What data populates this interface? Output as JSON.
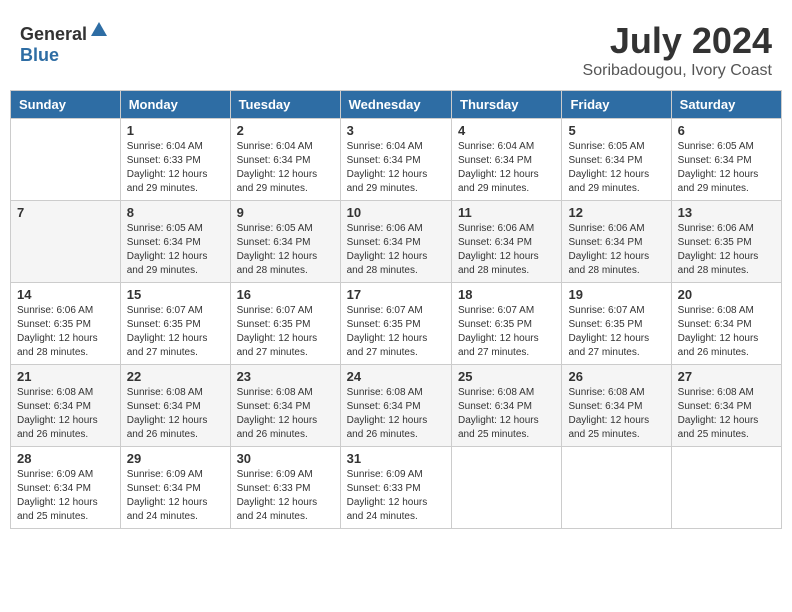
{
  "header": {
    "logo_general": "General",
    "logo_blue": "Blue",
    "month_year": "July 2024",
    "location": "Soribadougou, Ivory Coast"
  },
  "calendar": {
    "days_of_week": [
      "Sunday",
      "Monday",
      "Tuesday",
      "Wednesday",
      "Thursday",
      "Friday",
      "Saturday"
    ],
    "weeks": [
      [
        {
          "day": "",
          "info": ""
        },
        {
          "day": "1",
          "info": "Sunrise: 6:04 AM\nSunset: 6:33 PM\nDaylight: 12 hours\nand 29 minutes."
        },
        {
          "day": "2",
          "info": "Sunrise: 6:04 AM\nSunset: 6:34 PM\nDaylight: 12 hours\nand 29 minutes."
        },
        {
          "day": "3",
          "info": "Sunrise: 6:04 AM\nSunset: 6:34 PM\nDaylight: 12 hours\nand 29 minutes."
        },
        {
          "day": "4",
          "info": "Sunrise: 6:04 AM\nSunset: 6:34 PM\nDaylight: 12 hours\nand 29 minutes."
        },
        {
          "day": "5",
          "info": "Sunrise: 6:05 AM\nSunset: 6:34 PM\nDaylight: 12 hours\nand 29 minutes."
        },
        {
          "day": "6",
          "info": "Sunrise: 6:05 AM\nSunset: 6:34 PM\nDaylight: 12 hours\nand 29 minutes."
        }
      ],
      [
        {
          "day": "7",
          "info": ""
        },
        {
          "day": "8",
          "info": "Sunrise: 6:05 AM\nSunset: 6:34 PM\nDaylight: 12 hours\nand 29 minutes."
        },
        {
          "day": "9",
          "info": "Sunrise: 6:05 AM\nSunset: 6:34 PM\nDaylight: 12 hours\nand 28 minutes."
        },
        {
          "day": "10",
          "info": "Sunrise: 6:06 AM\nSunset: 6:34 PM\nDaylight: 12 hours\nand 28 minutes."
        },
        {
          "day": "11",
          "info": "Sunrise: 6:06 AM\nSunset: 6:34 PM\nDaylight: 12 hours\nand 28 minutes."
        },
        {
          "day": "12",
          "info": "Sunrise: 6:06 AM\nSunset: 6:34 PM\nDaylight: 12 hours\nand 28 minutes."
        },
        {
          "day": "13",
          "info": "Sunrise: 6:06 AM\nSunset: 6:35 PM\nDaylight: 12 hours\nand 28 minutes."
        }
      ],
      [
        {
          "day": "14",
          "info": "Sunrise: 6:06 AM\nSunset: 6:35 PM\nDaylight: 12 hours\nand 28 minutes."
        },
        {
          "day": "15",
          "info": "Sunrise: 6:07 AM\nSunset: 6:35 PM\nDaylight: 12 hours\nand 27 minutes."
        },
        {
          "day": "16",
          "info": "Sunrise: 6:07 AM\nSunset: 6:35 PM\nDaylight: 12 hours\nand 27 minutes."
        },
        {
          "day": "17",
          "info": "Sunrise: 6:07 AM\nSunset: 6:35 PM\nDaylight: 12 hours\nand 27 minutes."
        },
        {
          "day": "18",
          "info": "Sunrise: 6:07 AM\nSunset: 6:35 PM\nDaylight: 12 hours\nand 27 minutes."
        },
        {
          "day": "19",
          "info": "Sunrise: 6:07 AM\nSunset: 6:35 PM\nDaylight: 12 hours\nand 27 minutes."
        },
        {
          "day": "20",
          "info": "Sunrise: 6:08 AM\nSunset: 6:34 PM\nDaylight: 12 hours\nand 26 minutes."
        }
      ],
      [
        {
          "day": "21",
          "info": "Sunrise: 6:08 AM\nSunset: 6:34 PM\nDaylight: 12 hours\nand 26 minutes."
        },
        {
          "day": "22",
          "info": "Sunrise: 6:08 AM\nSunset: 6:34 PM\nDaylight: 12 hours\nand 26 minutes."
        },
        {
          "day": "23",
          "info": "Sunrise: 6:08 AM\nSunset: 6:34 PM\nDaylight: 12 hours\nand 26 minutes."
        },
        {
          "day": "24",
          "info": "Sunrise: 6:08 AM\nSunset: 6:34 PM\nDaylight: 12 hours\nand 26 minutes."
        },
        {
          "day": "25",
          "info": "Sunrise: 6:08 AM\nSunset: 6:34 PM\nDaylight: 12 hours\nand 25 minutes."
        },
        {
          "day": "26",
          "info": "Sunrise: 6:08 AM\nSunset: 6:34 PM\nDaylight: 12 hours\nand 25 minutes."
        },
        {
          "day": "27",
          "info": "Sunrise: 6:08 AM\nSunset: 6:34 PM\nDaylight: 12 hours\nand 25 minutes."
        }
      ],
      [
        {
          "day": "28",
          "info": "Sunrise: 6:09 AM\nSunset: 6:34 PM\nDaylight: 12 hours\nand 25 minutes."
        },
        {
          "day": "29",
          "info": "Sunrise: 6:09 AM\nSunset: 6:34 PM\nDaylight: 12 hours\nand 24 minutes."
        },
        {
          "day": "30",
          "info": "Sunrise: 6:09 AM\nSunset: 6:33 PM\nDaylight: 12 hours\nand 24 minutes."
        },
        {
          "day": "31",
          "info": "Sunrise: 6:09 AM\nSunset: 6:33 PM\nDaylight: 12 hours\nand 24 minutes."
        },
        {
          "day": "",
          "info": ""
        },
        {
          "day": "",
          "info": ""
        },
        {
          "day": "",
          "info": ""
        }
      ]
    ]
  }
}
